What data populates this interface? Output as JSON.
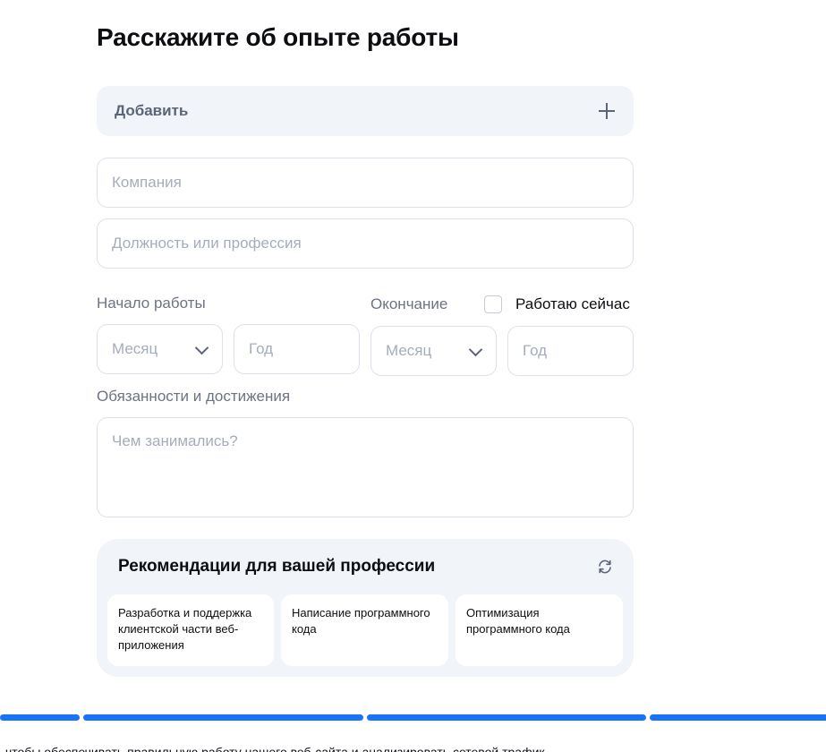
{
  "page": {
    "title": "Расскажите об опыте работы"
  },
  "add": {
    "label": "Добавить",
    "icon": "plus-icon"
  },
  "fields": {
    "company_placeholder": "Компания",
    "position_placeholder": "Должность или профессия"
  },
  "dates": {
    "start_label": "Начало работы",
    "end_label": "Окончание",
    "working_now_label": "Работаю сейчас",
    "working_now_checked": false,
    "month_placeholder": "Месяц",
    "year_placeholder": "Год"
  },
  "duties": {
    "label": "Обязанности и достижения",
    "placeholder": "Чем занимались?"
  },
  "recommendations": {
    "title": "Рекомендации для вашей профессии",
    "items": [
      "Разработка и поддержка клиентской части веб-приложения",
      "Написание программного кода",
      "Оптимизация программного кода"
    ]
  },
  "progress": {
    "segments": 4,
    "completed_segments": 4,
    "color": "#1a73f5"
  },
  "footer": {
    "text": "чтобы обеспечивать правильную работу нашего веб-сайта и анализировать сетевой трафик"
  }
}
